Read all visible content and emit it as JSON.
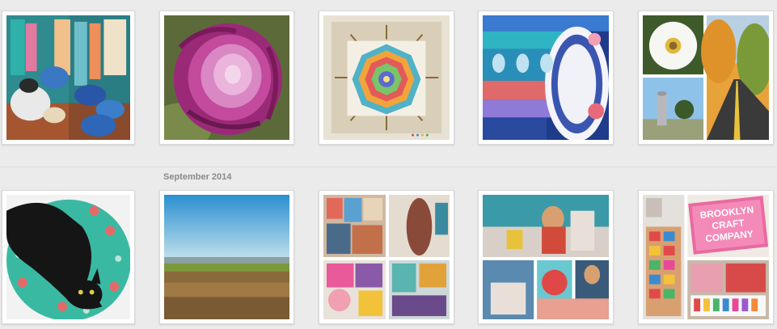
{
  "feed": {
    "month_label": "September 2014"
  },
  "photos": {
    "brooklyn_sign_line1": "BROOKLYN",
    "brooklyn_sign_line2": "CRAFT",
    "brooklyn_sign_line3": "COMPANY"
  },
  "colors": {
    "page_background": "#ebebeb",
    "card_background": "#ffffff",
    "card_border": "#d8d8d8",
    "month_label": "#8a8a8a"
  }
}
